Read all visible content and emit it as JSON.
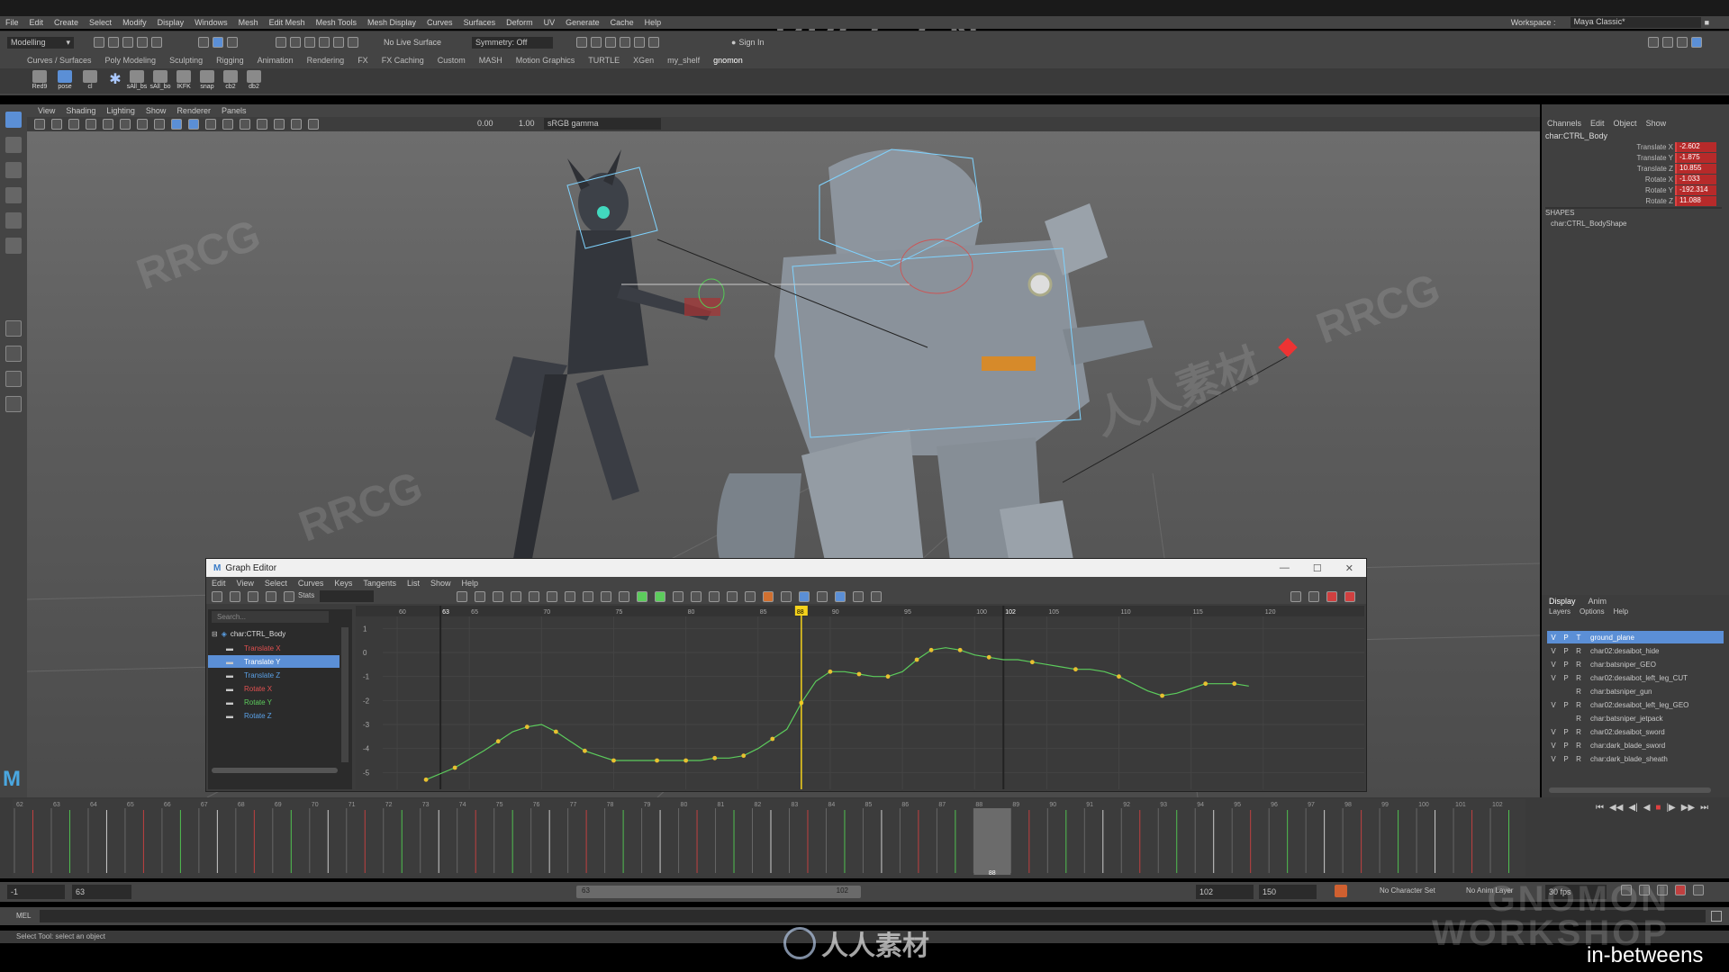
{
  "top_watermark": "RRCG.CN",
  "menu": [
    "File",
    "Edit",
    "Create",
    "Select",
    "Modify",
    "Display",
    "Windows",
    "Mesh",
    "Edit Mesh",
    "Mesh Tools",
    "Mesh Display",
    "Curves",
    "Surfaces",
    "Deform",
    "UV",
    "Generate",
    "Cache",
    "Help"
  ],
  "workspace": {
    "label": "Workspace :",
    "value": "Maya Classic*"
  },
  "status_line": {
    "mode": "Modelling",
    "live_surface": "No Live Surface",
    "symmetry": "Symmetry: Off",
    "sign_in": "Sign In"
  },
  "shelf_tabs": [
    "Curves / Surfaces",
    "Poly Modeling",
    "Sculpting",
    "Rigging",
    "Animation",
    "Rendering",
    "FX",
    "FX Caching",
    "Custom",
    "MASH",
    "Motion Graphics",
    "TURTLE",
    "XGen",
    "my_shelf",
    "gnomon"
  ],
  "shelf_active": "gnomon",
  "shelf_buttons": [
    "Red9",
    "pose",
    "cl",
    "",
    "sAll_bs",
    "sAll_bo",
    "IKFK",
    "snap",
    "cb2",
    "db2"
  ],
  "viewport": {
    "menu": [
      "View",
      "Shading",
      "Lighting",
      "Show",
      "Renderer",
      "Panels"
    ],
    "field1": "0.00",
    "field2": "1.00",
    "color_space": "sRGB gamma"
  },
  "channel_box": {
    "tabs": [
      "Channels",
      "Edit",
      "Object",
      "Show"
    ],
    "object": "char:CTRL_Body",
    "attributes": [
      {
        "name": "Translate X",
        "value": "-2.602"
      },
      {
        "name": "Translate Y",
        "value": "-1.875"
      },
      {
        "name": "Translate Z",
        "value": "10.855"
      },
      {
        "name": "Rotate X",
        "value": "-1.033"
      },
      {
        "name": "Rotate Y",
        "value": "-192.314"
      },
      {
        "name": "Rotate Z",
        "value": "11.088"
      }
    ],
    "shapes_header": "SHAPES",
    "shape": "char:CTRL_BodyShape"
  },
  "layer_editor": {
    "tabs": [
      "Display",
      "Anim"
    ],
    "menu": [
      "Layers",
      "Options",
      "Help"
    ],
    "layers": [
      {
        "v": "V",
        "p": "P",
        "r": "T",
        "name": "ground_plane",
        "selected": true
      },
      {
        "v": "V",
        "p": "P",
        "r": "R",
        "name": "char02:desaibot_hide"
      },
      {
        "v": "V",
        "p": "P",
        "r": "R",
        "name": "char:batsniper_GEO"
      },
      {
        "v": "V",
        "p": "P",
        "r": "R",
        "name": "char02:desaibot_left_leg_CUT"
      },
      {
        "v": "",
        "p": "",
        "r": "R",
        "name": "char:batsniper_gun"
      },
      {
        "v": "V",
        "p": "P",
        "r": "R",
        "name": "char02:desaibot_left_leg_GEO"
      },
      {
        "v": "",
        "p": "",
        "r": "R",
        "name": "char:batsniper_jetpack"
      },
      {
        "v": "V",
        "p": "P",
        "r": "R",
        "name": "char02:desaibot_sword"
      },
      {
        "v": "V",
        "p": "P",
        "r": "R",
        "name": "char:dark_blade_sword"
      },
      {
        "v": "V",
        "p": "P",
        "r": "R",
        "name": "char:dark_blade_sheath"
      }
    ]
  },
  "graph_editor": {
    "title": "Graph Editor",
    "menu": [
      "Edit",
      "View",
      "Select",
      "Curves",
      "Keys",
      "Tangents",
      "List",
      "Show",
      "Help"
    ],
    "stats_label": "Stats",
    "search_placeholder": "Search...",
    "node": "char:CTRL_Body",
    "channels": [
      {
        "name": "Translate X",
        "color": "#e05050"
      },
      {
        "name": "Translate Y",
        "color": "#ffffff",
        "selected": true
      },
      {
        "name": "Translate Z",
        "color": "#5aa0e6"
      },
      {
        "name": "Rotate X",
        "color": "#e05050"
      },
      {
        "name": "Rotate Y",
        "color": "#5ccc5c"
      },
      {
        "name": "Rotate Z",
        "color": "#5aa0e6"
      }
    ],
    "frame_ticks": [
      "60",
      "65",
      "70",
      "75",
      "80",
      "85",
      "90",
      "95",
      "100",
      "105",
      "110",
      "115",
      "120"
    ],
    "start_marker": "63",
    "end_marker": "102",
    "current_frame": "88",
    "value_ticks": [
      "1",
      "0",
      "-1",
      "-2",
      "-3",
      "-4",
      "-5"
    ],
    "curve": {
      "frames": [
        62,
        64,
        66,
        67,
        68,
        69,
        70,
        71,
        72,
        73,
        74,
        75,
        76,
        77,
        78,
        79,
        80,
        81,
        82,
        83,
        84,
        85,
        86,
        87,
        88,
        89,
        90,
        91,
        92,
        93,
        94,
        95,
        96,
        97,
        98,
        99,
        100,
        101,
        102,
        103,
        104,
        105,
        106,
        107,
        108,
        109,
        110,
        111,
        112,
        113,
        114,
        115,
        116,
        117,
        118,
        119
      ],
      "values": [
        -5.3,
        -4.8,
        -4.1,
        -3.7,
        -3.3,
        -3.1,
        -3.0,
        -3.3,
        -3.7,
        -4.1,
        -4.3,
        -4.5,
        -4.5,
        -4.5,
        -4.5,
        -4.5,
        -4.5,
        -4.5,
        -4.4,
        -4.4,
        -4.3,
        -4.0,
        -3.6,
        -3.2,
        -2.1,
        -1.2,
        -0.8,
        -0.8,
        -0.9,
        -1.0,
        -1.0,
        -0.8,
        -0.3,
        0.1,
        0.2,
        0.1,
        -0.1,
        -0.2,
        -0.3,
        -0.3,
        -0.4,
        -0.5,
        -0.6,
        -0.7,
        -0.7,
        -0.8,
        -1.0,
        -1.3,
        -1.6,
        -1.8,
        -1.7,
        -1.5,
        -1.3,
        -1.3,
        -1.3,
        -1.4
      ],
      "key_frames": [
        62,
        64,
        67,
        69,
        71,
        73,
        75,
        78,
        80,
        82,
        84,
        86,
        88,
        90,
        92,
        94,
        96,
        97,
        99,
        101,
        104,
        107,
        110,
        113,
        116,
        118
      ]
    }
  },
  "timeline": {
    "ticks": [
      "62",
      "63",
      "64",
      "65",
      "66",
      "67",
      "68",
      "69",
      "70",
      "71",
      "72",
      "73",
      "74",
      "75",
      "76",
      "77",
      "78",
      "79",
      "80",
      "81",
      "82",
      "83",
      "84",
      "85",
      "86",
      "87",
      "88",
      "89",
      "90",
      "91",
      "92",
      "93",
      "94",
      "95",
      "96",
      "97",
      "98",
      "99",
      "100",
      "101",
      "102"
    ],
    "current_frame": "88"
  },
  "range": {
    "anim_start": "-1",
    "start": "63",
    "slider_start": "63",
    "slider_end": "102",
    "end": "102",
    "anim_end": "150",
    "character_set": "No Character Set",
    "anim_layer": "No Anim Layer",
    "fps": "30 fps"
  },
  "command_line": {
    "lang": "MEL"
  },
  "help_line": "Select Tool: select an object",
  "bottom_watermark": "人人素材",
  "brand": [
    "GNOMON",
    "WORKSHOP"
  ],
  "caption": "in-betweens",
  "colors": {
    "selection_blue": "#5b8fd6",
    "channel_red": "#b72a2a",
    "current_time": "#f5d21b",
    "curve_key": "#e8c030"
  }
}
